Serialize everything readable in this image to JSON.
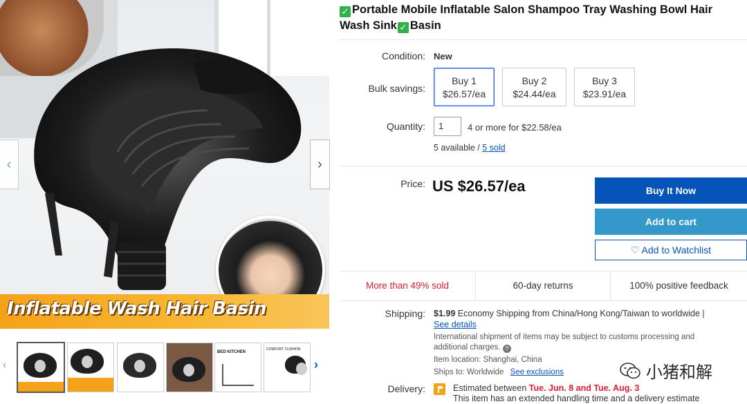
{
  "product": {
    "title_text": "Portable Mobile Inflatable Salon Shampoo Tray Washing Bowl Hair Wash Sink",
    "title_end": "Basin",
    "check_glyph": "✓"
  },
  "gallery": {
    "banner_text": "Inflatable Wash Hair Basin",
    "prev_glyph": "‹",
    "next_glyph": "›",
    "thumb_prev_glyph": "‹",
    "thumb_next_glyph": "›",
    "thumbnails": [
      {
        "label": "",
        "active": true
      },
      {
        "label": "Inflatable Wash Hair Basin",
        "active": false
      },
      {
        "label": "",
        "active": false
      },
      {
        "label": "",
        "active": false
      },
      {
        "label": "BED  KITCHEN",
        "active": false
      },
      {
        "label": "COMFORT CUSHION",
        "active": false
      }
    ]
  },
  "details": {
    "condition_label": "Condition:",
    "condition_value": "New",
    "bulk_label": "Bulk savings:",
    "bulk_options": [
      {
        "line1": "Buy 1",
        "line2": "$26.57/ea",
        "selected": true
      },
      {
        "line1": "Buy 2",
        "line2": "$24.44/ea",
        "selected": false
      },
      {
        "line1": "Buy 3",
        "line2": "$23.91/ea",
        "selected": false
      }
    ],
    "quantity_label": "Quantity:",
    "quantity_value": "1",
    "quantity_note": "4 or more for $22.58/ea",
    "available_text": "5 available / ",
    "sold_link": "5 sold",
    "price_label": "Price:",
    "price_value": "US $26.57/ea"
  },
  "actions": {
    "buy_now": "Buy It Now",
    "add_to_cart": "Add to cart",
    "watchlist": "Add to Watchlist",
    "heart_glyph": "♡"
  },
  "stats": {
    "sold_pct": "More than 49% sold",
    "returns": "60-day returns",
    "feedback": "100% positive feedback",
    "red_color": "#dd1e31"
  },
  "shipping": {
    "label": "Shipping:",
    "price": "$1.99",
    "service": "Economy Shipping from China/Hong Kong/Taiwan to worldwide |",
    "details_link": "See details",
    "intl_note_1": "International shipment of items may be subject to customs processing and",
    "intl_note_2": "additional charges.",
    "location": "Item location: Shanghai, China",
    "ships_to": "Ships to: Worldwide",
    "exclusions_link": "See exclusions"
  },
  "delivery": {
    "label": "Delivery:",
    "estimated": "Estimated between",
    "date_range": "Tue. Jun. 8 and Tue. Aug. 3",
    "note": "This item has an extended handling time and a delivery estimate"
  },
  "watermark": {
    "text": "小猪和解"
  },
  "colors": {
    "primary_blue": "#0654ba",
    "cart_blue": "#3498ca",
    "banner_orange": "#f5a21a"
  }
}
